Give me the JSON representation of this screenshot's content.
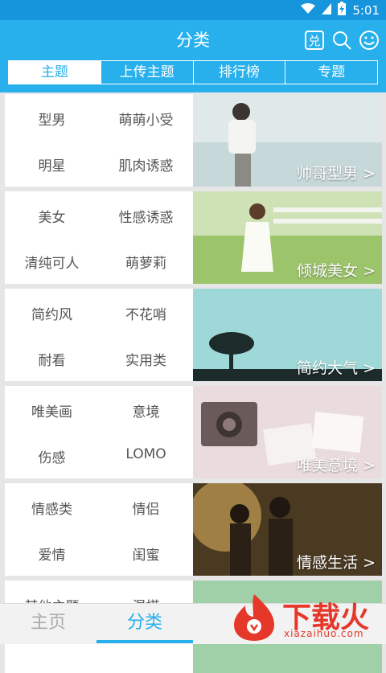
{
  "status_bar": {
    "time": "5:01",
    "icons": [
      "wifi-icon",
      "cellular-signal-icon",
      "battery-charging-icon"
    ]
  },
  "app_bar": {
    "title": "分类",
    "actions": [
      "redeem-icon",
      "search-icon",
      "smiley-icon"
    ],
    "redeem_glyph": "兑"
  },
  "tabs": [
    {
      "label": "主题",
      "active": true
    },
    {
      "label": "上传主题",
      "active": false
    },
    {
      "label": "排行榜",
      "active": false
    },
    {
      "label": "专题",
      "active": false
    }
  ],
  "categories": [
    {
      "tags": [
        "型男",
        "萌萌小受",
        "明星",
        "肌肉诱惑"
      ],
      "caption": "帅哥型男 >"
    },
    {
      "tags": [
        "美女",
        "性感诱惑",
        "清纯可人",
        "萌萝莉"
      ],
      "caption": "倾城美女 >"
    },
    {
      "tags": [
        "简约风",
        "不花哨",
        "耐看",
        "实用类"
      ],
      "caption": "简约大气 >"
    },
    {
      "tags": [
        "唯美画",
        "意境",
        "伤感",
        "LOMO"
      ],
      "caption": "唯美意境 >"
    },
    {
      "tags": [
        "情感类",
        "情侣",
        "爱情",
        "闺蜜"
      ],
      "caption": "情感生活 >"
    },
    {
      "tags": [
        "其他主题",
        "混搭",
        "",
        ""
      ],
      "caption": ""
    }
  ],
  "bottom_nav": [
    {
      "label": "主页",
      "active": false
    },
    {
      "label": "分类",
      "active": true
    }
  ],
  "watermark": {
    "text": "下载火",
    "subtext": "xiazaihuo.com"
  },
  "colors": {
    "accent": "#27b0ec",
    "status_bar": "#1695dc",
    "watermark": "#e5382a"
  }
}
